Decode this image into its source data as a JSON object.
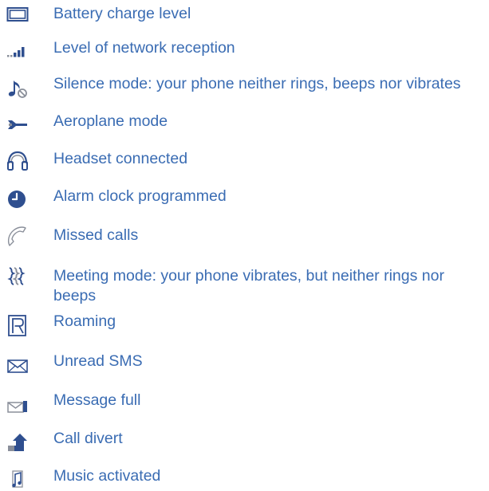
{
  "items": [
    {
      "label": "Battery charge level",
      "icon": "battery-icon"
    },
    {
      "label": "Level of network reception",
      "icon": "signal-bars-icon"
    },
    {
      "label": "Silence mode: your phone neither rings, beeps nor vibrates",
      "icon": "silent-mode-icon"
    },
    {
      "label": "Aeroplane mode",
      "icon": "airplane-icon"
    },
    {
      "label": "Headset connected",
      "icon": "headset-icon"
    },
    {
      "label": "Alarm clock programmed",
      "icon": "alarm-clock-icon"
    },
    {
      "label": "Missed calls",
      "icon": "missed-call-icon"
    },
    {
      "label": "Meeting mode: your phone vibrates, but neither rings nor beeps",
      "icon": "vibrate-icon"
    },
    {
      "label": "Roaming",
      "icon": "roaming-icon"
    },
    {
      "label": "Unread SMS",
      "icon": "envelope-icon"
    },
    {
      "label": "Message full",
      "icon": "message-full-icon"
    },
    {
      "label": "Call divert",
      "icon": "call-divert-icon"
    },
    {
      "label": "Music activated",
      "icon": "music-note-icon"
    }
  ],
  "colors": {
    "text": "#3a6cb3",
    "icon_blue": "#2f4f8f",
    "icon_grey": "#8a8f9a"
  }
}
